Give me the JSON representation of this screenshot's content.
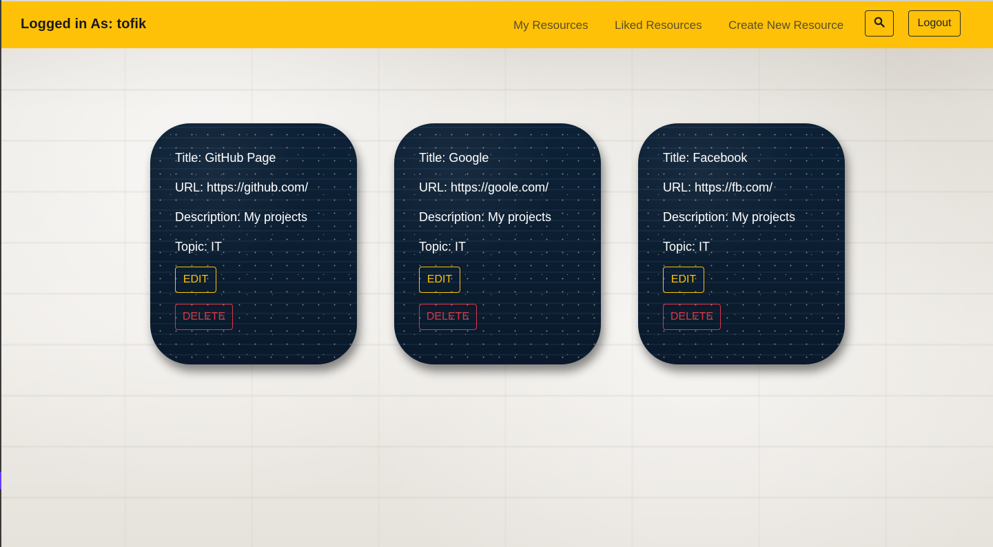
{
  "header": {
    "brand": "Logged in As: tofik",
    "nav": {
      "my_resources": "My Resources",
      "liked_resources": "Liked Resources",
      "create_new_resource": "Create New Resource"
    },
    "search_icon": "search-icon",
    "logout_label": "Logout"
  },
  "colors": {
    "navbar": "#ffc107",
    "card_background": "#0c1f33",
    "edit": "#ffc107",
    "delete": "#dc3545"
  },
  "cards": [
    {
      "title": "Title: GitHub Page",
      "url": "URL: https://github.com/",
      "description": "Description: My projects",
      "topic": "Topic: IT",
      "edit_label": "EDIT",
      "delete_label": "DELETE"
    },
    {
      "title": "Title: Google",
      "url": "URL: https://goole.com/",
      "description": "Description: My projects",
      "topic": "Topic: IT",
      "edit_label": "EDIT",
      "delete_label": "DELETE"
    },
    {
      "title": "Title: Facebook",
      "url": "URL: https://fb.com/",
      "description": "Description: My projects",
      "topic": "Topic: IT",
      "edit_label": "EDIT",
      "delete_label": "DELETE"
    }
  ]
}
